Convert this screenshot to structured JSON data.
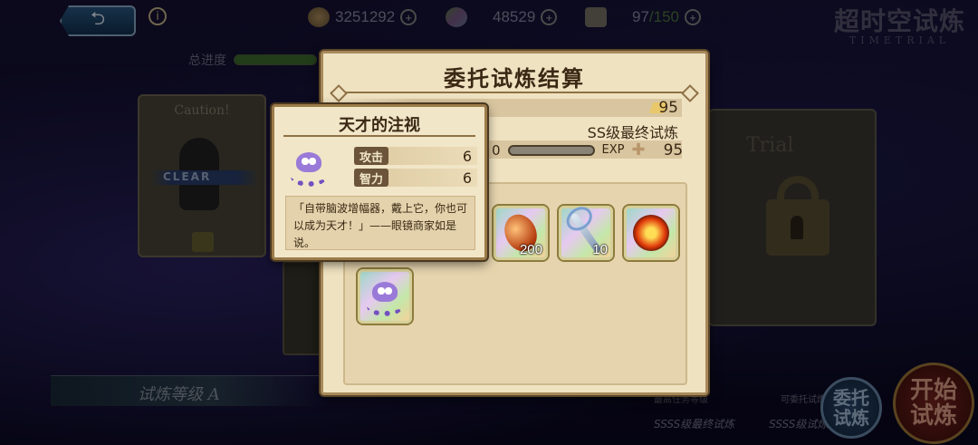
{
  "topbar": {
    "back_icon": "return-arrow-icon",
    "info_icon": "info-icon",
    "gold": "3251292",
    "gems": "48529",
    "stamina": "97",
    "stamina_max": "/150",
    "game_title": "超时空试炼",
    "game_title_en": "TIMETRIAL"
  },
  "progress": {
    "label": "总进度",
    "fraction": 1.0
  },
  "background": {
    "caution": "Caution!",
    "clear": "CLEAR",
    "locked_word": "Trial",
    "rank_label": "试炼等级 A",
    "stat1_label": "最高任务等级",
    "stat2_label": "可委托试炼至",
    "stat1_value": "SSSS级最终试炼",
    "stat2_value": "SSSS级试炼4",
    "entrust_button": "委托\n试炼",
    "start_button": "开始\n试炼"
  },
  "dialog": {
    "title": "委托试炼结算",
    "gold_reward": "95",
    "stage_name": "SS级最终试炼",
    "exp_prefix": "0",
    "exp_label": "EXP",
    "exp_plus": "✚",
    "exp_value": "95",
    "items": [
      {
        "name": "red-nut-icon",
        "qty": "200"
      },
      {
        "name": "staff-icon",
        "qty": "10"
      },
      {
        "name": "sun-emblem-icon",
        "qty": ""
      },
      {
        "name": "squid-icon",
        "qty": ""
      }
    ]
  },
  "tooltip": {
    "title": "天才的注视",
    "stats": [
      {
        "label": "攻击",
        "value": "6"
      },
      {
        "label": "智力",
        "value": "6"
      }
    ],
    "description": "「自带脑波增幅器，戴上它，你也可以成为天才！」——眼镜商家如是说。"
  }
}
